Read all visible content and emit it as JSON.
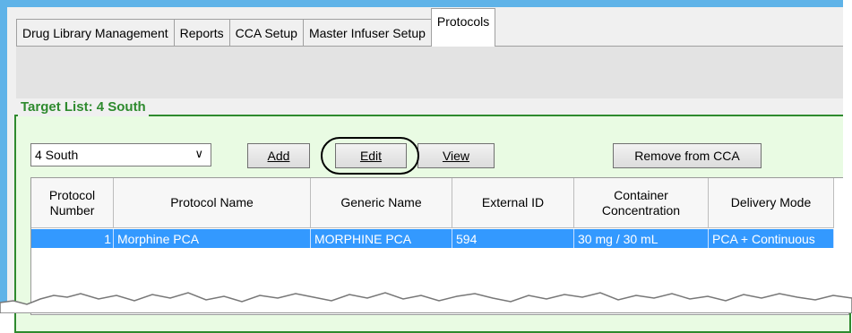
{
  "tabs": [
    {
      "label": "Drug Library Management",
      "active": false
    },
    {
      "label": "Reports",
      "active": false
    },
    {
      "label": "CCA Setup",
      "active": false
    },
    {
      "label": "Master Infuser Setup",
      "active": false
    },
    {
      "label": "Protocols",
      "active": true
    }
  ],
  "target_list": {
    "title": "Target List: 4 South",
    "selected": "4 South"
  },
  "buttons": {
    "add": "Add",
    "edit": "Edit",
    "view": "View",
    "remove": "Remove from CCA"
  },
  "table": {
    "columns": [
      "Protocol Number",
      "Protocol Name",
      "Generic Name",
      "External ID",
      "Container Concentration",
      "Delivery Mode"
    ],
    "rows": [
      [
        "1",
        "Morphine PCA",
        "MORPHINE PCA",
        "594",
        "30 mg / 30 mL",
        "PCA + Continuous"
      ]
    ]
  },
  "colors": {
    "accent_green": "#2e8a2e",
    "selection_blue": "#3399ff",
    "frame_blue": "#5fb3e8"
  }
}
